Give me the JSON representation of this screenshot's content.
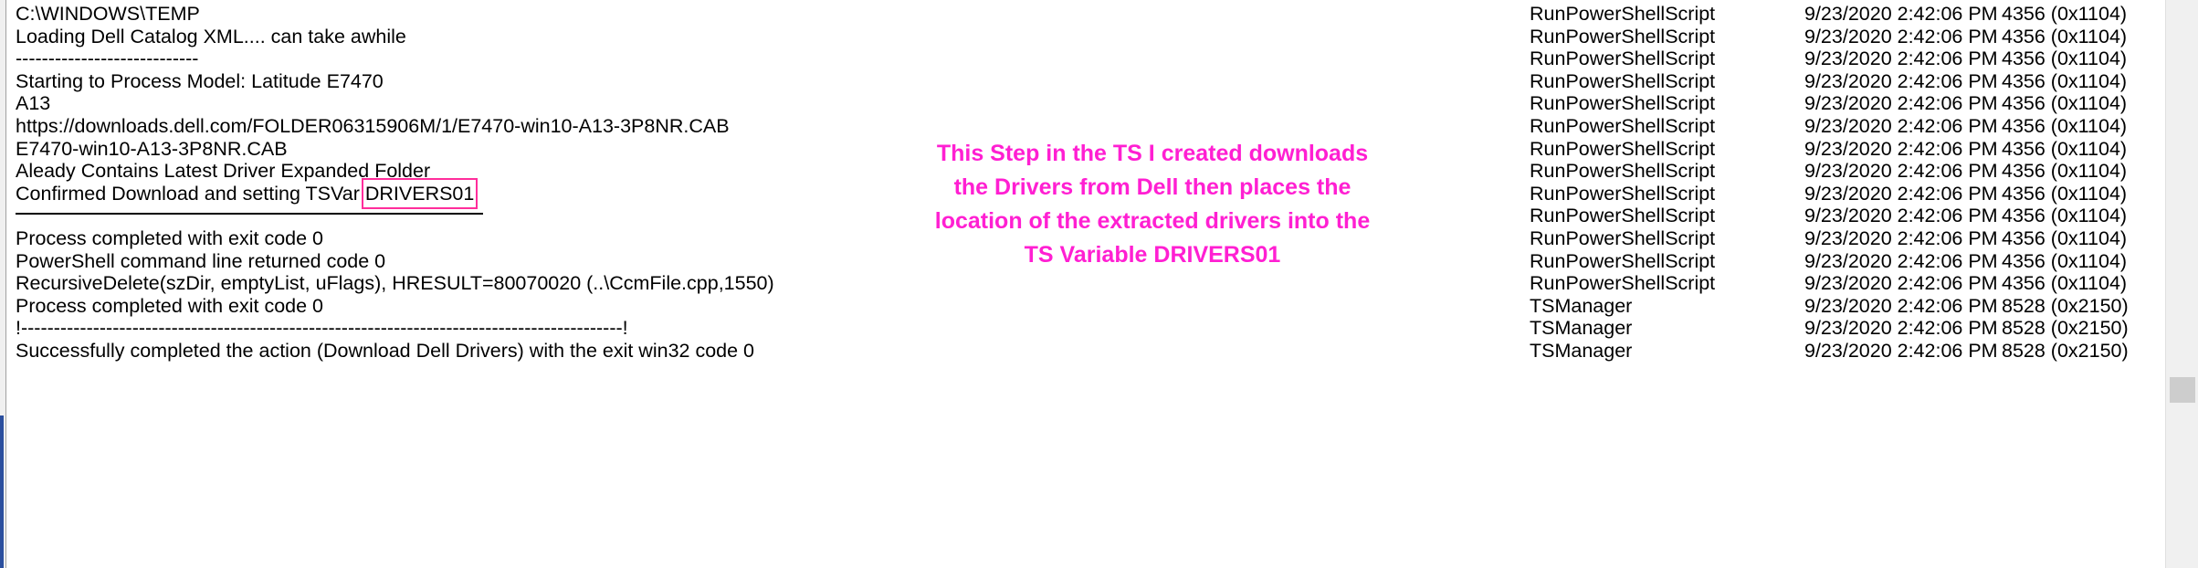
{
  "log": {
    "top_partial": "",
    "rows": [
      {
        "message": "C:\\WINDOWS\\TEMP",
        "component": "RunPowerShellScript",
        "time": "9/23/2020 2:42:06 PM",
        "thread": "4356 (0x1104)"
      },
      {
        "message": "Loading Dell Catalog XML.... can take awhile",
        "component": "RunPowerShellScript",
        "time": "9/23/2020 2:42:06 PM",
        "thread": "4356 (0x1104)"
      },
      {
        "message": "----------------------------",
        "component": "RunPowerShellScript",
        "time": "9/23/2020 2:42:06 PM",
        "thread": "4356 (0x1104)"
      },
      {
        "message": "Starting to Process Model: Latitude E7470",
        "component": "RunPowerShellScript",
        "time": "9/23/2020 2:42:06 PM",
        "thread": "4356 (0x1104)"
      },
      {
        "message": "A13",
        "component": "RunPowerShellScript",
        "time": "9/23/2020 2:42:06 PM",
        "thread": "4356 (0x1104)"
      },
      {
        "message": "https://downloads.dell.com/FOLDER06315906M/1/E7470-win10-A13-3P8NR.CAB",
        "component": "RunPowerShellScript",
        "time": "9/23/2020 2:42:06 PM",
        "thread": "4356 (0x1104)"
      },
      {
        "message": "E7470-win10-A13-3P8NR.CAB",
        "component": "RunPowerShellScript",
        "time": "9/23/2020 2:42:06 PM",
        "thread": "4356 (0x1104)"
      },
      {
        "message": "Aleady Contains Latest Driver Expanded Folder",
        "component": "RunPowerShellScript",
        "time": "9/23/2020 2:42:06 PM",
        "thread": "4356 (0x1104)"
      },
      {
        "message": "Confirmed Download and setting TSVar",
        "highlight": "DRIVERS01",
        "component": "RunPowerShellScript",
        "time": "9/23/2020 2:42:06 PM",
        "thread": "4356 (0x1104)"
      },
      {
        "message": "",
        "component": "RunPowerShellScript",
        "time": "9/23/2020 2:42:06 PM",
        "thread": "4356 (0x1104)"
      },
      {
        "message": "Process completed with exit code 0",
        "component": "RunPowerShellScript",
        "time": "9/23/2020 2:42:06 PM",
        "thread": "4356 (0x1104)"
      },
      {
        "message": "PowerShell command line returned code 0",
        "component": "RunPowerShellScript",
        "time": "9/23/2020 2:42:06 PM",
        "thread": "4356 (0x1104)"
      },
      {
        "message": "RecursiveDelete(szDir, emptyList, uFlags), HRESULT=80070020 (..\\CcmFile.cpp,1550)",
        "component": "RunPowerShellScript",
        "time": "9/23/2020 2:42:06 PM",
        "thread": "4356 (0x1104)"
      },
      {
        "message": "Process completed with exit code 0",
        "component": "TSManager",
        "time": "9/23/2020 2:42:06 PM",
        "thread": "8528 (0x2150)"
      },
      {
        "message": "!--------------------------------------------------------------------------------------------!",
        "component": "TSManager",
        "time": "9/23/2020 2:42:06 PM",
        "thread": "8528 (0x2150)"
      },
      {
        "message": "Successfully completed the action (Download Dell Drivers) with the exit win32 code 0",
        "component": "TSManager",
        "time": "9/23/2020 2:42:06 PM",
        "thread": "8528 (0x2150)"
      }
    ]
  },
  "annotation": {
    "lines": [
      "This Step in the TS I created downloads",
      "the Drivers from Dell then places the",
      "location of the extracted drivers into the",
      "TS Variable DRIVERS01"
    ],
    "color": "#ff1fd2"
  },
  "colors": {
    "highlight_box": "#ff2d9b",
    "background": "#ffffff",
    "text": "#000000"
  }
}
